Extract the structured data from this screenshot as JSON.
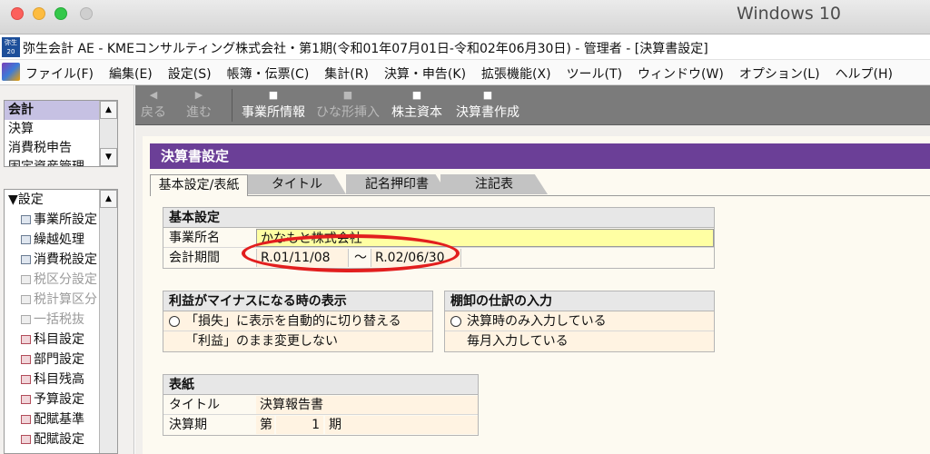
{
  "host": {
    "title": "Windows 10"
  },
  "app": {
    "title": "弥生会計 AE - KMEコンサルティング株式会社・第1期(令和01年07月01日-令和02年06月30日) - 管理者 - [決算書設定]",
    "icon_text": "弥生20"
  },
  "menu": [
    "ファイル(F)",
    "編集(E)",
    "設定(S)",
    "帳簿・伝票(C)",
    "集計(R)",
    "決算・申告(K)",
    "拡張機能(X)",
    "ツール(T)",
    "ウィンドウ(W)",
    "オプション(L)",
    "ヘルプ(H)"
  ],
  "nav": {
    "categories": [
      "会計",
      "決算",
      "消費税申告",
      "固定資産管理"
    ],
    "tree_root": "▼設定",
    "tree_items": [
      {
        "label": "事業所設定",
        "disabled": false,
        "icon": "doc"
      },
      {
        "label": "繰越処理",
        "disabled": false,
        "icon": "doc"
      },
      {
        "label": "消費税設定",
        "disabled": false,
        "icon": "doc"
      },
      {
        "label": "税区分設定",
        "disabled": true,
        "icon": "doc"
      },
      {
        "label": "税計算区分",
        "disabled": true,
        "icon": "doc"
      },
      {
        "label": "一括税抜",
        "disabled": true,
        "icon": "doc"
      },
      {
        "label": "科目設定",
        "disabled": false,
        "icon": "red"
      },
      {
        "label": "部門設定",
        "disabled": false,
        "icon": "red"
      },
      {
        "label": "科目残高",
        "disabled": false,
        "icon": "red"
      },
      {
        "label": "予算設定",
        "disabled": false,
        "icon": "red"
      },
      {
        "label": "配賦基準",
        "disabled": false,
        "icon": "red"
      },
      {
        "label": "配賦設定",
        "disabled": false,
        "icon": "red"
      }
    ]
  },
  "toolbar": {
    "back": "戻る",
    "forward": "進む",
    "office_info": "事業所情報",
    "template_insert": "ひな形挿入",
    "equity": "株主資本",
    "create_statements": "決算書作成"
  },
  "page": {
    "header": "決算書設定",
    "tabs": [
      "基本設定/表紙",
      "タイトル",
      "記名押印書",
      "注記表"
    ]
  },
  "basic": {
    "title": "基本設定",
    "office_name_label": "事業所名",
    "office_name_value": "かなもと株式会社",
    "period_label": "会計期間",
    "period_start": "R.01/11/08",
    "period_sep": "〜",
    "period_end": "R.02/06/30"
  },
  "negative": {
    "title": "利益がマイナスになる時の表示",
    "opt1": "「損失」に表示を自動的に切り替える",
    "opt2": "「利益」のまま変更しない"
  },
  "inventory": {
    "title": "棚卸の仕訳の入力",
    "opt1": "決算時のみ入力している",
    "opt2": "毎月入力している"
  },
  "cover": {
    "title": "表紙",
    "title_label": "タイトル",
    "title_value": "決算報告書",
    "term_label": "決算期",
    "term_prefix": "第",
    "term_number": "1",
    "term_suffix": "期"
  }
}
